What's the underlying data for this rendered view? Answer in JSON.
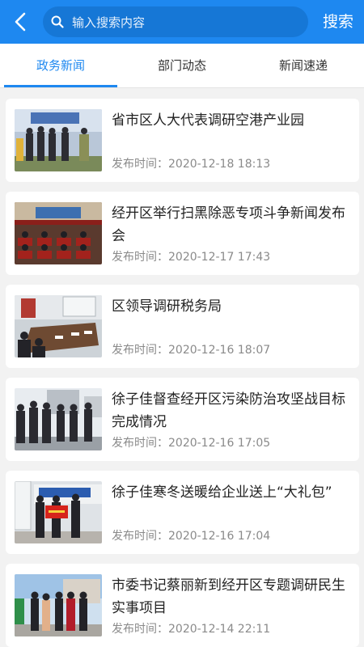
{
  "header": {
    "search_placeholder": "输入搜索内容",
    "search_button": "搜索",
    "brand_color": "#1e88f0"
  },
  "tabs": [
    {
      "label": "政务新闻",
      "active": true
    },
    {
      "label": "部门动态",
      "active": false
    },
    {
      "label": "新闻速递",
      "active": false
    }
  ],
  "news": [
    {
      "title": "省市区人大代表调研空港产业园",
      "time_label": "发布时间：",
      "time": "2020-12-18 18:13"
    },
    {
      "title": "经开区举行扫黑除恶专项斗争新闻发布会",
      "time_label": "发布时间：",
      "time": "2020-12-17 17:43"
    },
    {
      "title": "区领导调研税务局",
      "time_label": "发布时间：",
      "time": "2020-12-16 18:07"
    },
    {
      "title": "徐子佳督查经开区污染防治攻坚战目标完成情况",
      "time_label": "发布时间：",
      "time": "2020-12-16 17:05"
    },
    {
      "title": "徐子佳寒冬送暖给企业送上“大礼包”",
      "time_label": "发布时间：",
      "time": "2020-12-16 17:04"
    },
    {
      "title": "市委书记蔡丽新到经开区专题调研民生实事项目",
      "time_label": "发布时间：",
      "time": "2020-12-14 22:11"
    }
  ]
}
